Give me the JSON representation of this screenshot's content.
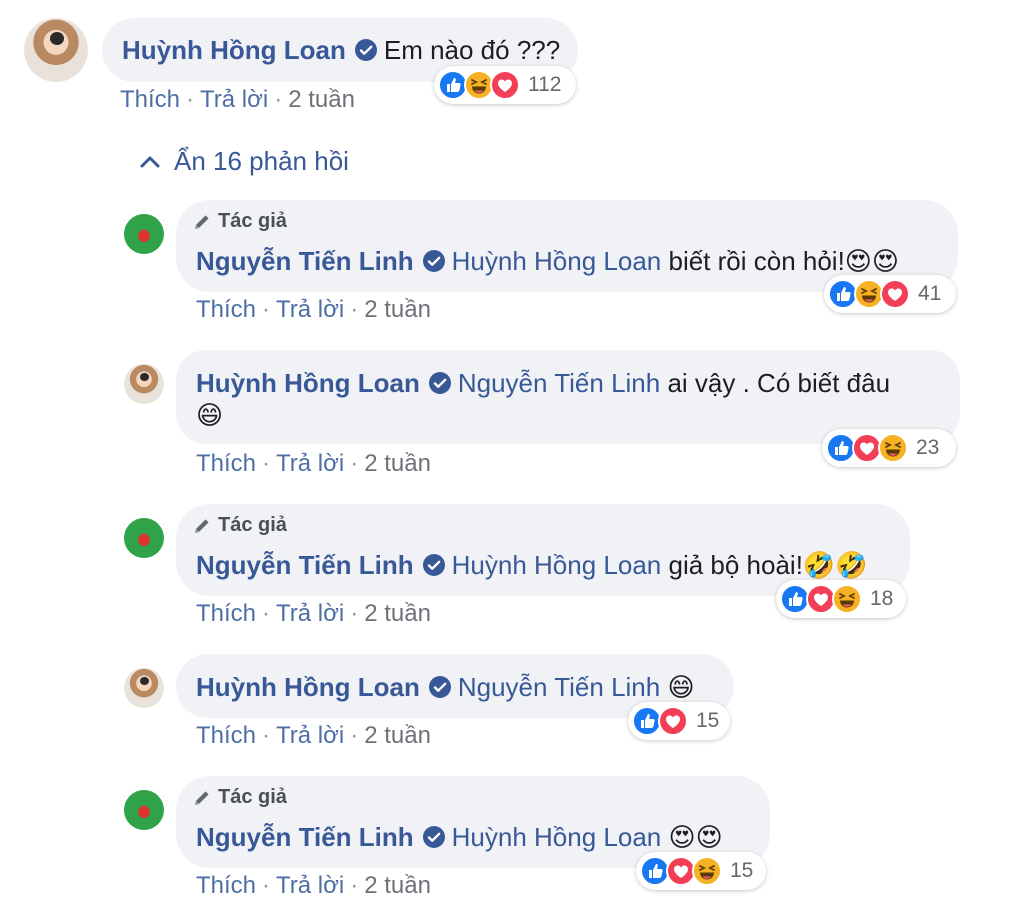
{
  "comment": {
    "author": "Huỳnh Hồng Loan",
    "text": "Em nào đó ???",
    "actions": {
      "like": "Thích",
      "reply": "Trả lời",
      "sep": "·",
      "time": "2 tuần"
    },
    "reactions": {
      "icons": [
        "like",
        "haha",
        "love"
      ],
      "count": "112"
    }
  },
  "toggle": {
    "label": "Ẩn 16 phản hồi",
    "icon": "chevron-up-icon"
  },
  "author_badge": "Tác giả",
  "replies": [
    {
      "author": "Nguyễn Tiến Linh",
      "is_author": true,
      "mention": "Huỳnh Hồng Loan",
      "text": "biết rồi còn hỏi!😍😍",
      "actions": {
        "like": "Thích",
        "reply": "Trả lời",
        "sep": "·",
        "time": "2 tuần"
      },
      "reactions": {
        "icons": [
          "like",
          "haha",
          "love"
        ],
        "count": "41"
      }
    },
    {
      "author": "Huỳnh Hồng Loan",
      "is_author": false,
      "mention": "Nguyễn Tiến Linh",
      "text": "ai vậy . Có biết đâu",
      "text2": "😄",
      "actions": {
        "like": "Thích",
        "reply": "Trả lời",
        "sep": "·",
        "time": "2 tuần"
      },
      "reactions": {
        "icons": [
          "like",
          "love",
          "haha"
        ],
        "count": "23"
      }
    },
    {
      "author": "Nguyễn Tiến Linh",
      "is_author": true,
      "mention": "Huỳnh Hồng Loan",
      "text": "giả bộ hoài!🤣🤣",
      "actions": {
        "like": "Thích",
        "reply": "Trả lời",
        "sep": "·",
        "time": "2 tuần"
      },
      "reactions": {
        "icons": [
          "like",
          "love",
          "haha"
        ],
        "count": "18"
      }
    },
    {
      "author": "Huỳnh Hồng Loan",
      "is_author": false,
      "mention": "Nguyễn Tiến Linh",
      "text": "😄",
      "actions": {
        "like": "Thích",
        "reply": "Trả lời",
        "sep": "·",
        "time": "2 tuần"
      },
      "reactions": {
        "icons": [
          "like",
          "love"
        ],
        "count": "15"
      }
    },
    {
      "author": "Nguyễn Tiến Linh",
      "is_author": true,
      "mention": "Huỳnh Hồng Loan",
      "text": "😍😍",
      "actions": {
        "like": "Thích",
        "reply": "Trả lời",
        "sep": "·",
        "time": "2 tuần"
      },
      "reactions": {
        "icons": [
          "like",
          "love",
          "haha"
        ],
        "count": "15"
      }
    }
  ],
  "colors": {
    "name": "#385898",
    "bubble": "#f0f2f5",
    "like": "#1877f2",
    "love": "#f33e58",
    "haha": "#f7b125"
  }
}
